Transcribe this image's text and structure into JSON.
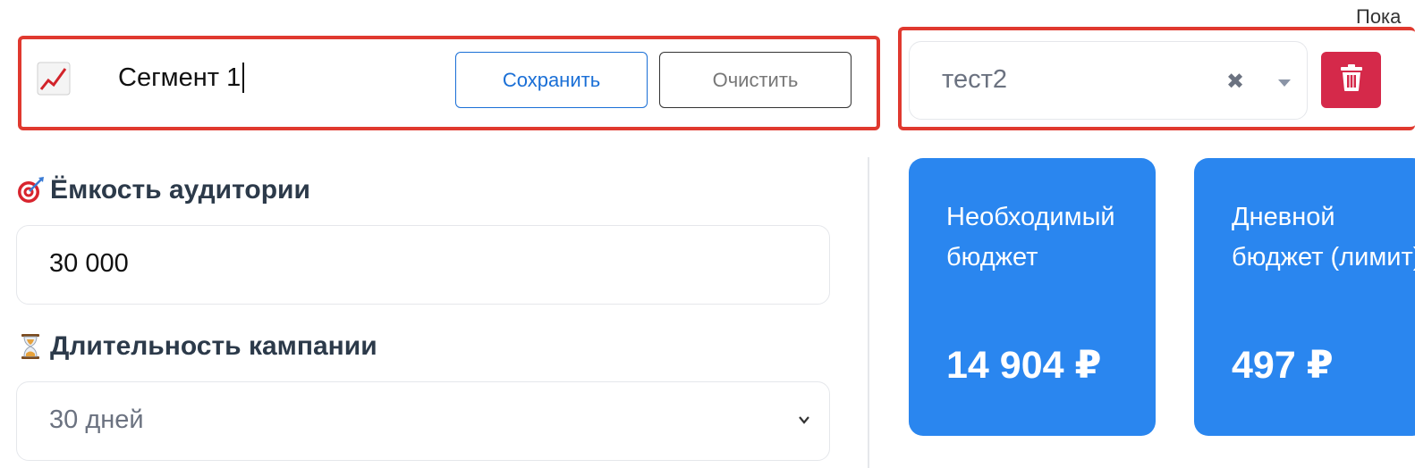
{
  "corner_text": "Пока",
  "segment": {
    "name": "Сегмент 1",
    "save_label": "Сохранить",
    "clear_label": "Очистить",
    "icon": "chart-increasing-icon"
  },
  "segment_select": {
    "value": "тест2",
    "clear_symbol": "✖",
    "delete_icon": "trash-icon"
  },
  "audience": {
    "label": "Ёмкость аудитории",
    "icon": "target-icon",
    "value": "30 000"
  },
  "duration": {
    "label": "Длительность кампании",
    "icon": "hourglass-icon",
    "value": "30 дней"
  },
  "cards": [
    {
      "title": "Необходимый бюджет",
      "value": "14 904 ₽"
    },
    {
      "title": "Дневной бюджет (лимит)",
      "value": "497 ₽"
    }
  ],
  "colors": {
    "accent": "#2a86ef",
    "danger": "#d5294a",
    "highlight": "#e0392f",
    "link": "#1a6fd6"
  }
}
